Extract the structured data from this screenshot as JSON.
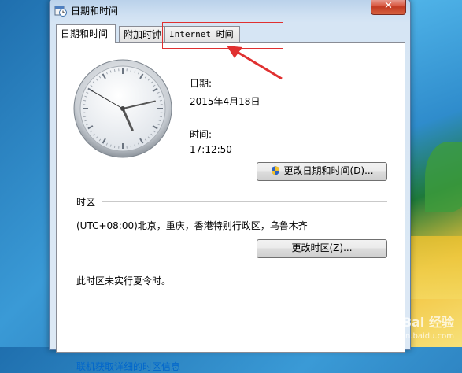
{
  "window": {
    "title": "日期和时间",
    "close_glyph": "✕"
  },
  "tabs": [
    {
      "label": "日期和时间",
      "active": true
    },
    {
      "label": "附加时钟",
      "active": false
    },
    {
      "label": "Internet 时间",
      "active": false
    }
  ],
  "date": {
    "label": "日期:",
    "value": "2015年4月18日"
  },
  "time": {
    "label": "时间:",
    "value": "17:12:50"
  },
  "buttons": {
    "change_datetime": "更改日期和时间(D)...",
    "change_timezone": "更改时区(Z)..."
  },
  "timezone": {
    "section_label": "时区",
    "value": "(UTC+08:00)北京，重庆，香港特别行政区，乌鲁木齐",
    "dst_note": "此时区未实行夏令时。"
  },
  "link": {
    "text": "联机获取详细的时区信息"
  },
  "watermark": {
    "brand": "Bai 经验",
    "url": "jingyan.baidu.com"
  },
  "colors": {
    "annotation": "#e03030",
    "link": "#0066cc"
  },
  "clock": {
    "hours": 17,
    "minutes": 12,
    "seconds": 50
  }
}
